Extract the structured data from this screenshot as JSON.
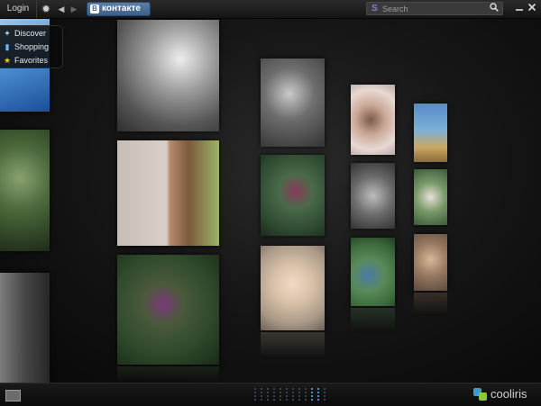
{
  "toolbar": {
    "login_label": "Login",
    "gear_icon": "gear-icon",
    "back_icon": "back-arrow-icon",
    "forward_icon": "forward-arrow-icon",
    "source_tab_label": "контакте",
    "source_tab_logo": "В",
    "search_placeholder": "Search",
    "search_logo": "S",
    "minimize_icon": "minimize-icon",
    "close_icon": "close-icon"
  },
  "side_menu": {
    "items": [
      {
        "label": "Discover",
        "icon": "sparkle-icon"
      },
      {
        "label": "Shopping",
        "icon": "shopping-bag-icon"
      },
      {
        "label": "Favorites",
        "icon": "star-icon"
      }
    ]
  },
  "footer": {
    "brand": "cooliris"
  },
  "colors": {
    "vk_blue": "#4a6e98",
    "accent_blue": "#4b8bd8"
  }
}
